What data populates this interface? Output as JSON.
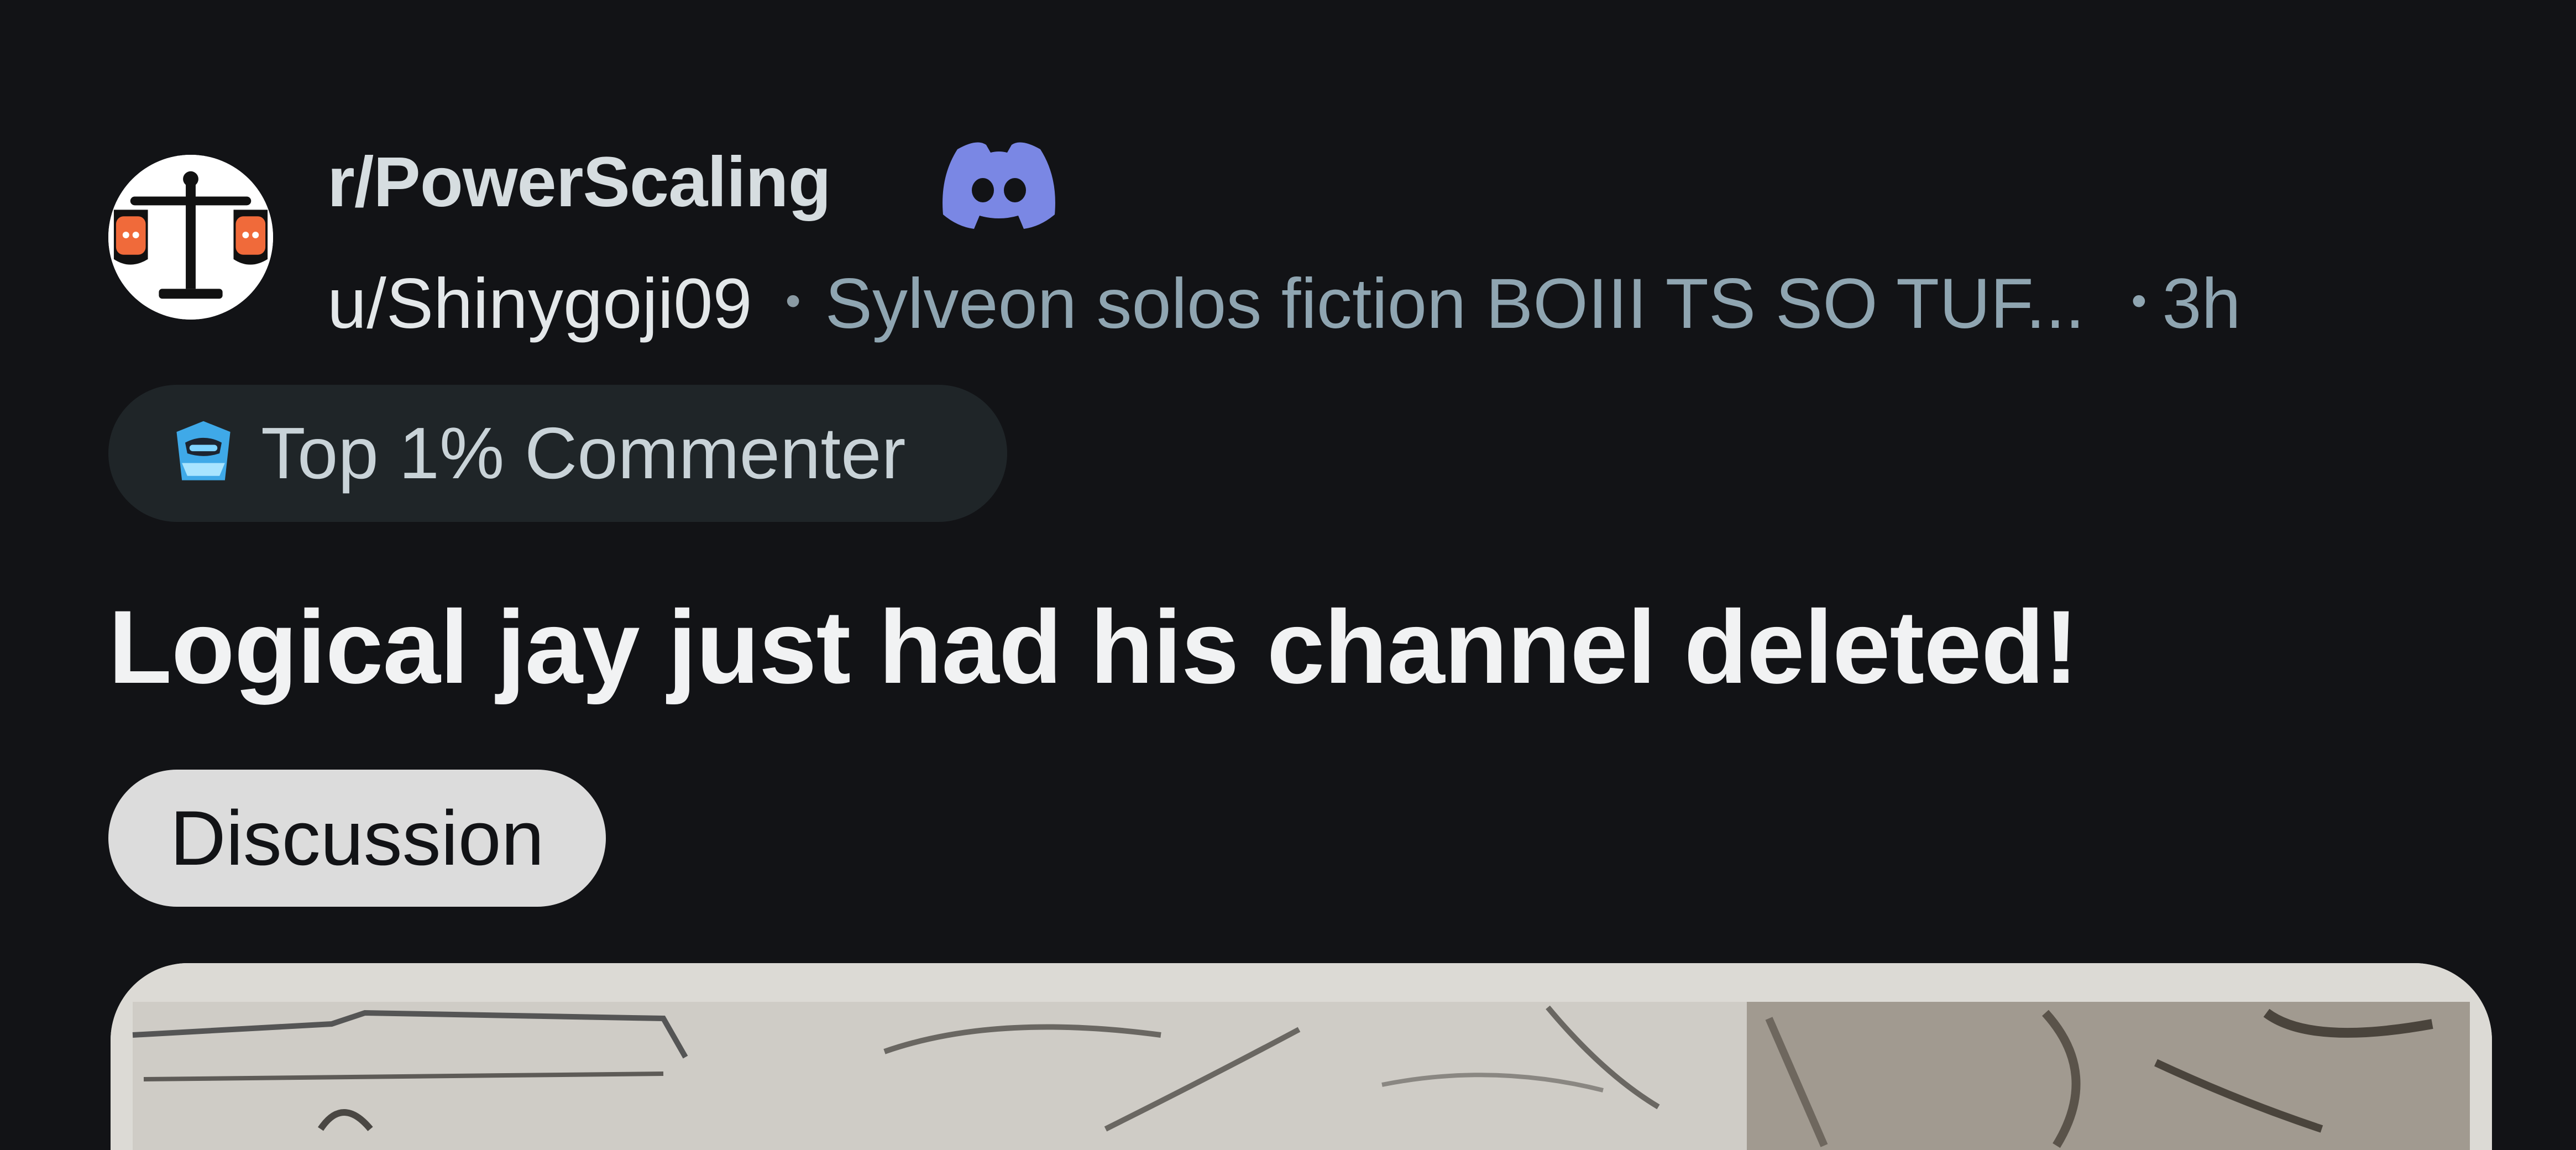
{
  "post": {
    "subreddit": "r/PowerScaling",
    "username": "u/Shinygoji09",
    "user_flair": "Sylveon solos fiction BOIII TS SO TUF...",
    "age": "3h",
    "badge_label": "Top 1% Commenter",
    "title": "Logical jay just had his channel deleted!",
    "post_flair": "Discussion"
  },
  "icons": {
    "subreddit_avatar": "scales-of-justice-icon",
    "discord": "discord-icon",
    "badge": "top-commenter-icon"
  },
  "colors": {
    "background": "#121316",
    "discord": "#7a87e4",
    "badge_bg": "#1f2528",
    "tag_bg": "#dcdcdc",
    "muted_text": "#8fa5b1"
  }
}
